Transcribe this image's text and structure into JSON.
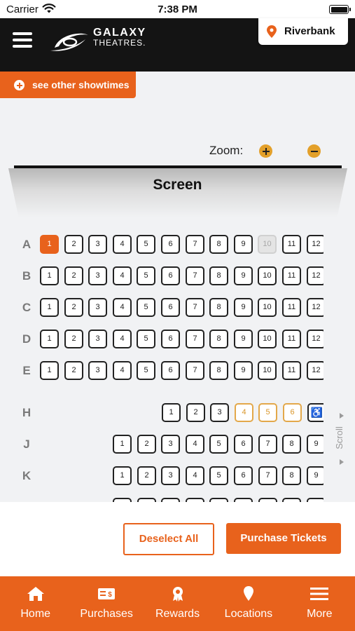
{
  "status_bar": {
    "carrier": "Carrier",
    "time": "7:38 PM"
  },
  "header": {
    "logo_line1": "GALAXY",
    "logo_line2": "THEATRES.",
    "location": "Riverbank"
  },
  "showtimes_button": "see other showtimes",
  "zoom": {
    "label": "Zoom:"
  },
  "screen_label": "Screen",
  "seat_map": {
    "rows": [
      {
        "label": "A",
        "seats": [
          {
            "n": "1",
            "state": "selected"
          },
          {
            "n": "2",
            "state": "available"
          },
          {
            "n": "3",
            "state": "available"
          },
          {
            "n": "4",
            "state": "available"
          },
          {
            "n": "5",
            "state": "available"
          },
          {
            "n": "6",
            "state": "available"
          },
          {
            "n": "7",
            "state": "available"
          },
          {
            "n": "8",
            "state": "available"
          },
          {
            "n": "9",
            "state": "available"
          },
          {
            "n": "10",
            "state": "unavailable"
          },
          {
            "n": "11",
            "state": "available"
          },
          {
            "n": "12",
            "state": "available"
          }
        ]
      },
      {
        "label": "B",
        "seats": [
          {
            "n": "1",
            "state": "available"
          },
          {
            "n": "2",
            "state": "available"
          },
          {
            "n": "3",
            "state": "available"
          },
          {
            "n": "4",
            "state": "available"
          },
          {
            "n": "5",
            "state": "available"
          },
          {
            "n": "6",
            "state": "available"
          },
          {
            "n": "7",
            "state": "available"
          },
          {
            "n": "8",
            "state": "available"
          },
          {
            "n": "9",
            "state": "available"
          },
          {
            "n": "10",
            "state": "available"
          },
          {
            "n": "11",
            "state": "available"
          },
          {
            "n": "12",
            "state": "available"
          }
        ]
      },
      {
        "label": "C",
        "seats": [
          {
            "n": "1",
            "state": "available"
          },
          {
            "n": "2",
            "state": "available"
          },
          {
            "n": "3",
            "state": "available"
          },
          {
            "n": "4",
            "state": "available"
          },
          {
            "n": "5",
            "state": "available"
          },
          {
            "n": "6",
            "state": "available"
          },
          {
            "n": "7",
            "state": "available"
          },
          {
            "n": "8",
            "state": "available"
          },
          {
            "n": "9",
            "state": "available"
          },
          {
            "n": "10",
            "state": "available"
          },
          {
            "n": "11",
            "state": "available"
          },
          {
            "n": "12",
            "state": "available"
          }
        ]
      },
      {
        "label": "D",
        "seats": [
          {
            "n": "1",
            "state": "available"
          },
          {
            "n": "2",
            "state": "available"
          },
          {
            "n": "3",
            "state": "available"
          },
          {
            "n": "4",
            "state": "available"
          },
          {
            "n": "5",
            "state": "available"
          },
          {
            "n": "6",
            "state": "available"
          },
          {
            "n": "7",
            "state": "available"
          },
          {
            "n": "8",
            "state": "available"
          },
          {
            "n": "9",
            "state": "available"
          },
          {
            "n": "10",
            "state": "available"
          },
          {
            "n": "11",
            "state": "available"
          },
          {
            "n": "12",
            "state": "available"
          }
        ]
      },
      {
        "label": "E",
        "seats": [
          {
            "n": "1",
            "state": "available"
          },
          {
            "n": "2",
            "state": "available"
          },
          {
            "n": "3",
            "state": "available"
          },
          {
            "n": "4",
            "state": "available"
          },
          {
            "n": "5",
            "state": "available"
          },
          {
            "n": "6",
            "state": "available"
          },
          {
            "n": "7",
            "state": "available"
          },
          {
            "n": "8",
            "state": "available"
          },
          {
            "n": "9",
            "state": "available"
          },
          {
            "n": "10",
            "state": "available"
          },
          {
            "n": "11",
            "state": "available"
          },
          {
            "n": "12",
            "state": "available"
          }
        ]
      },
      {
        "label": "H",
        "seats": [
          {
            "n": "1",
            "state": "available"
          },
          {
            "n": "2",
            "state": "available"
          },
          {
            "n": "3",
            "state": "available"
          },
          {
            "n": "4",
            "state": "companion"
          },
          {
            "n": "5",
            "state": "companion"
          },
          {
            "n": "6",
            "state": "companion"
          },
          {
            "n": "",
            "state": "wheelchair"
          }
        ]
      },
      {
        "label": "J",
        "seats": [
          {
            "n": "1",
            "state": "available"
          },
          {
            "n": "2",
            "state": "available"
          },
          {
            "n": "3",
            "state": "available"
          },
          {
            "n": "4",
            "state": "available"
          },
          {
            "n": "5",
            "state": "available"
          },
          {
            "n": "6",
            "state": "available"
          },
          {
            "n": "7",
            "state": "available"
          },
          {
            "n": "8",
            "state": "available"
          },
          {
            "n": "9",
            "state": "available"
          }
        ]
      },
      {
        "label": "K",
        "seats": [
          {
            "n": "1",
            "state": "available"
          },
          {
            "n": "2",
            "state": "available"
          },
          {
            "n": "3",
            "state": "available"
          },
          {
            "n": "4",
            "state": "available"
          },
          {
            "n": "5",
            "state": "available"
          },
          {
            "n": "6",
            "state": "available"
          },
          {
            "n": "7",
            "state": "available"
          },
          {
            "n": "8",
            "state": "available"
          },
          {
            "n": "9",
            "state": "available"
          }
        ]
      },
      {
        "label": "",
        "seats": [
          {
            "n": "",
            "state": "available"
          },
          {
            "n": "",
            "state": "available"
          },
          {
            "n": "",
            "state": "available"
          },
          {
            "n": "",
            "state": "available"
          },
          {
            "n": "",
            "state": "available"
          },
          {
            "n": "",
            "state": "available"
          },
          {
            "n": "",
            "state": "available"
          },
          {
            "n": "",
            "state": "available"
          },
          {
            "n": "",
            "state": "available"
          }
        ]
      }
    ],
    "scroll_label": "Scroll"
  },
  "actions": {
    "deselect": "Deselect All",
    "purchase": "Purchase Tickets"
  },
  "bottom_nav": [
    {
      "label": "Home",
      "icon": "home-icon"
    },
    {
      "label": "Purchases",
      "icon": "ticket-icon"
    },
    {
      "label": "Rewards",
      "icon": "award-icon"
    },
    {
      "label": "Locations",
      "icon": "location-pin-icon"
    },
    {
      "label": "More",
      "icon": "menu-icon"
    }
  ],
  "colors": {
    "accent": "#e8621c",
    "header": "#141414",
    "companion": "#e3a84a"
  }
}
